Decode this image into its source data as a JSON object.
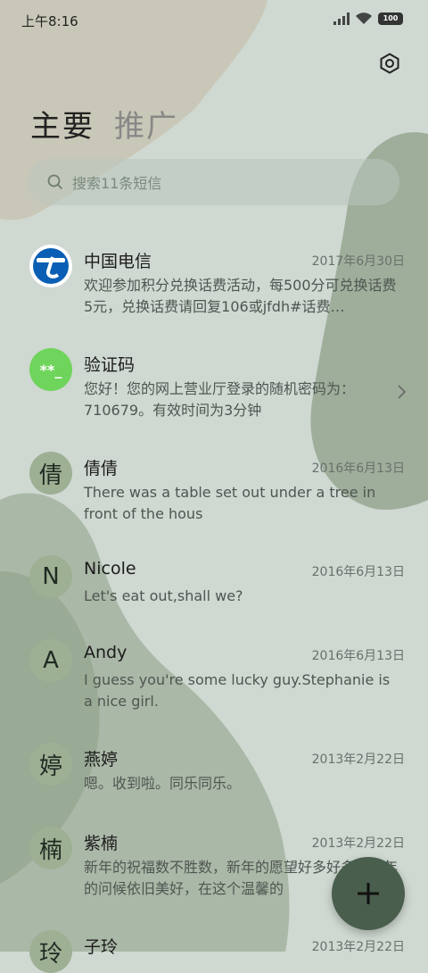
{
  "status": {
    "time": "上午8:16",
    "battery": "100"
  },
  "tabs": [
    {
      "label": "主要"
    },
    {
      "label": "推广"
    }
  ],
  "search": {
    "placeholder": "搜索11条短信"
  },
  "messages": [
    {
      "name": "中国电信",
      "date": "2017年6月30日",
      "preview": "欢迎参加积分兑换话费活动，每500分可兑换话费5元，兑换话费请回复106或jfdh#话费…",
      "avatar": "telecom-logo"
    },
    {
      "name": "验证码",
      "date": "",
      "preview": "您好！您的网上营业厅登录的随机密码为：710679。有效时间为3分钟",
      "avatar_text": "**_"
    },
    {
      "name": "倩倩",
      "date": "2016年6月13日",
      "preview": "There was a table set out under a tree in front of the hous",
      "avatar_text": "倩"
    },
    {
      "name": "Nicole",
      "date": "2016年6月13日",
      "preview": "Let's eat out,shall we?",
      "avatar_text": "N"
    },
    {
      "name": "Andy",
      "date": "2016年6月13日",
      "preview": "I guess you're some lucky guy.Stephanie is a nice girl.",
      "avatar_text": "A"
    },
    {
      "name": "燕婷",
      "date": "2013年2月22日",
      "preview": "嗯。收到啦。同乐同乐。",
      "avatar_text": "婷"
    },
    {
      "name": "紫楠",
      "date": "2013年2月22日",
      "preview": "新年的祝福数不胜数，新年的愿望好多好多，新年的问候依旧美好，在这个温馨的",
      "avatar_text": "楠"
    },
    {
      "name": "子玲",
      "date": "2013年2月22日",
      "preview": "",
      "avatar_text": "玲"
    }
  ],
  "fab": {
    "icon": "plus-icon"
  },
  "colors": {
    "accent": "#4a5e4d",
    "verify_avatar": "#6fd45b",
    "telecom_blue": "#0a5fb4"
  }
}
